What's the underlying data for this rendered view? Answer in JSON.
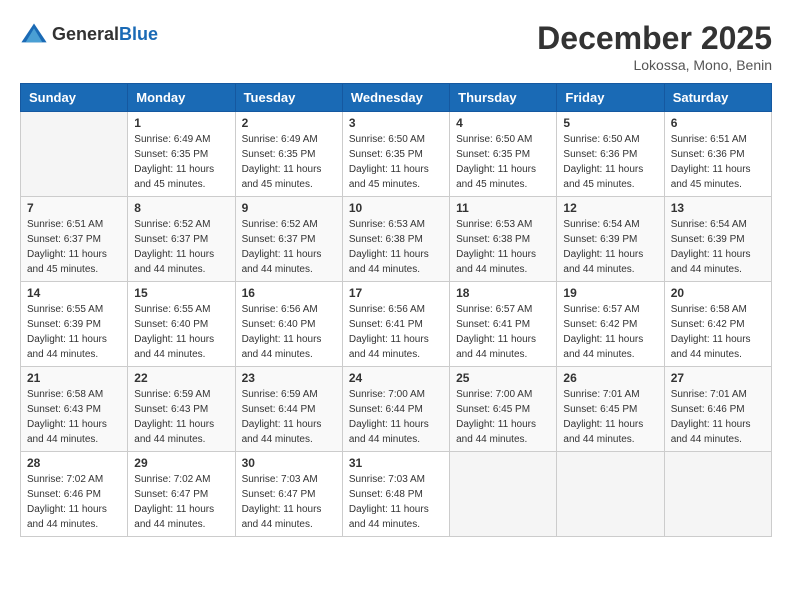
{
  "header": {
    "logo_general": "General",
    "logo_blue": "Blue",
    "month_title": "December 2025",
    "location": "Lokossa, Mono, Benin"
  },
  "calendar": {
    "days_of_week": [
      "Sunday",
      "Monday",
      "Tuesday",
      "Wednesday",
      "Thursday",
      "Friday",
      "Saturday"
    ],
    "weeks": [
      [
        {
          "day": "",
          "sunrise": "",
          "sunset": "",
          "daylight": ""
        },
        {
          "day": "1",
          "sunrise": "Sunrise: 6:49 AM",
          "sunset": "Sunset: 6:35 PM",
          "daylight": "Daylight: 11 hours and 45 minutes."
        },
        {
          "day": "2",
          "sunrise": "Sunrise: 6:49 AM",
          "sunset": "Sunset: 6:35 PM",
          "daylight": "Daylight: 11 hours and 45 minutes."
        },
        {
          "day": "3",
          "sunrise": "Sunrise: 6:50 AM",
          "sunset": "Sunset: 6:35 PM",
          "daylight": "Daylight: 11 hours and 45 minutes."
        },
        {
          "day": "4",
          "sunrise": "Sunrise: 6:50 AM",
          "sunset": "Sunset: 6:35 PM",
          "daylight": "Daylight: 11 hours and 45 minutes."
        },
        {
          "day": "5",
          "sunrise": "Sunrise: 6:50 AM",
          "sunset": "Sunset: 6:36 PM",
          "daylight": "Daylight: 11 hours and 45 minutes."
        },
        {
          "day": "6",
          "sunrise": "Sunrise: 6:51 AM",
          "sunset": "Sunset: 6:36 PM",
          "daylight": "Daylight: 11 hours and 45 minutes."
        }
      ],
      [
        {
          "day": "7",
          "sunrise": "Sunrise: 6:51 AM",
          "sunset": "Sunset: 6:37 PM",
          "daylight": "Daylight: 11 hours and 45 minutes."
        },
        {
          "day": "8",
          "sunrise": "Sunrise: 6:52 AM",
          "sunset": "Sunset: 6:37 PM",
          "daylight": "Daylight: 11 hours and 44 minutes."
        },
        {
          "day": "9",
          "sunrise": "Sunrise: 6:52 AM",
          "sunset": "Sunset: 6:37 PM",
          "daylight": "Daylight: 11 hours and 44 minutes."
        },
        {
          "day": "10",
          "sunrise": "Sunrise: 6:53 AM",
          "sunset": "Sunset: 6:38 PM",
          "daylight": "Daylight: 11 hours and 44 minutes."
        },
        {
          "day": "11",
          "sunrise": "Sunrise: 6:53 AM",
          "sunset": "Sunset: 6:38 PM",
          "daylight": "Daylight: 11 hours and 44 minutes."
        },
        {
          "day": "12",
          "sunrise": "Sunrise: 6:54 AM",
          "sunset": "Sunset: 6:39 PM",
          "daylight": "Daylight: 11 hours and 44 minutes."
        },
        {
          "day": "13",
          "sunrise": "Sunrise: 6:54 AM",
          "sunset": "Sunset: 6:39 PM",
          "daylight": "Daylight: 11 hours and 44 minutes."
        }
      ],
      [
        {
          "day": "14",
          "sunrise": "Sunrise: 6:55 AM",
          "sunset": "Sunset: 6:39 PM",
          "daylight": "Daylight: 11 hours and 44 minutes."
        },
        {
          "day": "15",
          "sunrise": "Sunrise: 6:55 AM",
          "sunset": "Sunset: 6:40 PM",
          "daylight": "Daylight: 11 hours and 44 minutes."
        },
        {
          "day": "16",
          "sunrise": "Sunrise: 6:56 AM",
          "sunset": "Sunset: 6:40 PM",
          "daylight": "Daylight: 11 hours and 44 minutes."
        },
        {
          "day": "17",
          "sunrise": "Sunrise: 6:56 AM",
          "sunset": "Sunset: 6:41 PM",
          "daylight": "Daylight: 11 hours and 44 minutes."
        },
        {
          "day": "18",
          "sunrise": "Sunrise: 6:57 AM",
          "sunset": "Sunset: 6:41 PM",
          "daylight": "Daylight: 11 hours and 44 minutes."
        },
        {
          "day": "19",
          "sunrise": "Sunrise: 6:57 AM",
          "sunset": "Sunset: 6:42 PM",
          "daylight": "Daylight: 11 hours and 44 minutes."
        },
        {
          "day": "20",
          "sunrise": "Sunrise: 6:58 AM",
          "sunset": "Sunset: 6:42 PM",
          "daylight": "Daylight: 11 hours and 44 minutes."
        }
      ],
      [
        {
          "day": "21",
          "sunrise": "Sunrise: 6:58 AM",
          "sunset": "Sunset: 6:43 PM",
          "daylight": "Daylight: 11 hours and 44 minutes."
        },
        {
          "day": "22",
          "sunrise": "Sunrise: 6:59 AM",
          "sunset": "Sunset: 6:43 PM",
          "daylight": "Daylight: 11 hours and 44 minutes."
        },
        {
          "day": "23",
          "sunrise": "Sunrise: 6:59 AM",
          "sunset": "Sunset: 6:44 PM",
          "daylight": "Daylight: 11 hours and 44 minutes."
        },
        {
          "day": "24",
          "sunrise": "Sunrise: 7:00 AM",
          "sunset": "Sunset: 6:44 PM",
          "daylight": "Daylight: 11 hours and 44 minutes."
        },
        {
          "day": "25",
          "sunrise": "Sunrise: 7:00 AM",
          "sunset": "Sunset: 6:45 PM",
          "daylight": "Daylight: 11 hours and 44 minutes."
        },
        {
          "day": "26",
          "sunrise": "Sunrise: 7:01 AM",
          "sunset": "Sunset: 6:45 PM",
          "daylight": "Daylight: 11 hours and 44 minutes."
        },
        {
          "day": "27",
          "sunrise": "Sunrise: 7:01 AM",
          "sunset": "Sunset: 6:46 PM",
          "daylight": "Daylight: 11 hours and 44 minutes."
        }
      ],
      [
        {
          "day": "28",
          "sunrise": "Sunrise: 7:02 AM",
          "sunset": "Sunset: 6:46 PM",
          "daylight": "Daylight: 11 hours and 44 minutes."
        },
        {
          "day": "29",
          "sunrise": "Sunrise: 7:02 AM",
          "sunset": "Sunset: 6:47 PM",
          "daylight": "Daylight: 11 hours and 44 minutes."
        },
        {
          "day": "30",
          "sunrise": "Sunrise: 7:03 AM",
          "sunset": "Sunset: 6:47 PM",
          "daylight": "Daylight: 11 hours and 44 minutes."
        },
        {
          "day": "31",
          "sunrise": "Sunrise: 7:03 AM",
          "sunset": "Sunset: 6:48 PM",
          "daylight": "Daylight: 11 hours and 44 minutes."
        },
        {
          "day": "",
          "sunrise": "",
          "sunset": "",
          "daylight": ""
        },
        {
          "day": "",
          "sunrise": "",
          "sunset": "",
          "daylight": ""
        },
        {
          "day": "",
          "sunrise": "",
          "sunset": "",
          "daylight": ""
        }
      ]
    ]
  }
}
